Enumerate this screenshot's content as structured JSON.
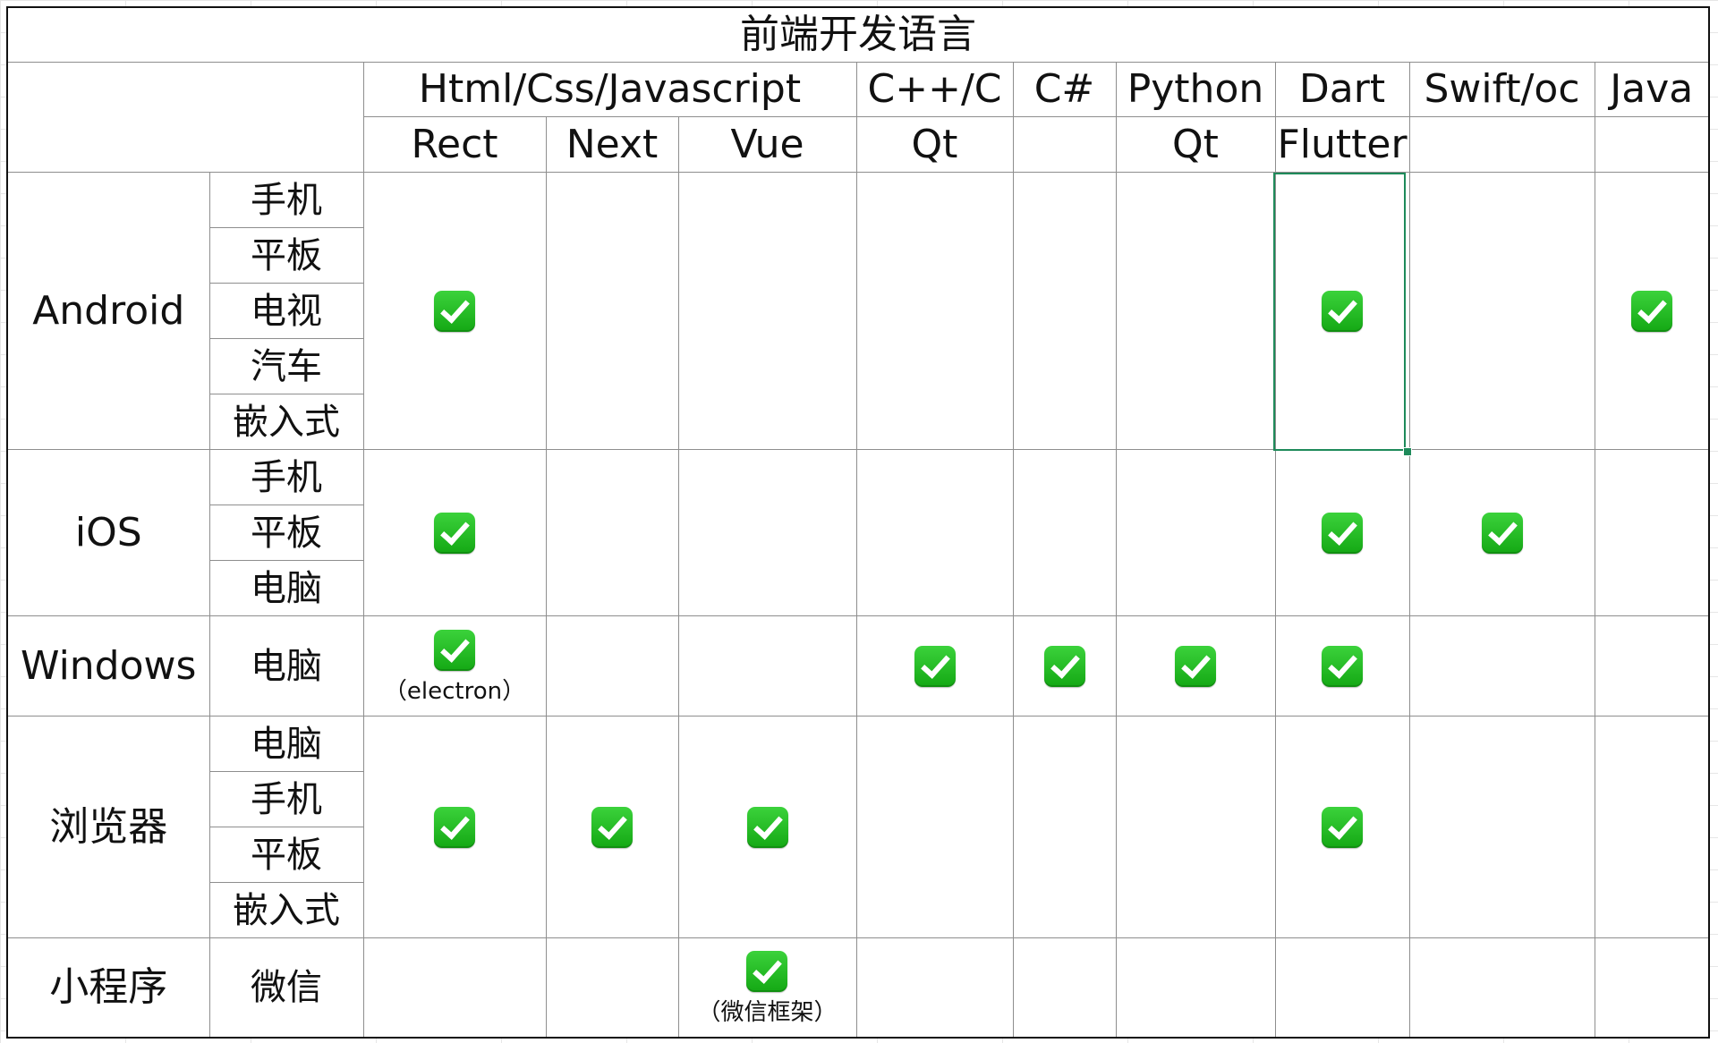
{
  "title": "前端开发语言",
  "languages": {
    "html": "Html/Css/Javascript",
    "cpp": "C++/C",
    "csharp": "C#",
    "python": "Python",
    "dart": "Dart",
    "swift": "Swift/oc",
    "java": "Java"
  },
  "frameworks": {
    "react": "Rect",
    "next": "Next",
    "vue": "Vue",
    "cpp_qt": "Qt",
    "python_qt": "Qt",
    "flutter": "Flutter"
  },
  "platforms": {
    "android": {
      "label": "Android",
      "devices": [
        "手机",
        "平板",
        "电视",
        "汽车",
        "嵌入式"
      ]
    },
    "ios": {
      "label": "iOS",
      "devices": [
        "手机",
        "平板",
        "电脑"
      ]
    },
    "windows": {
      "label": "Windows",
      "devices": [
        "电脑"
      ]
    },
    "browser": {
      "label": "浏览器",
      "devices": [
        "电脑",
        "手机",
        "平板",
        "嵌入式"
      ]
    },
    "miniprogram": {
      "label": "小程序",
      "devices": [
        "微信"
      ]
    }
  },
  "notes": {
    "electron": "（electron）",
    "wechat_framework": "（微信框架）"
  },
  "icons": {
    "check": "check-mark-icon"
  },
  "colors": {
    "check": "#1fb81f",
    "selection": "#1e8a5a",
    "border": "#8e8e8e"
  }
}
